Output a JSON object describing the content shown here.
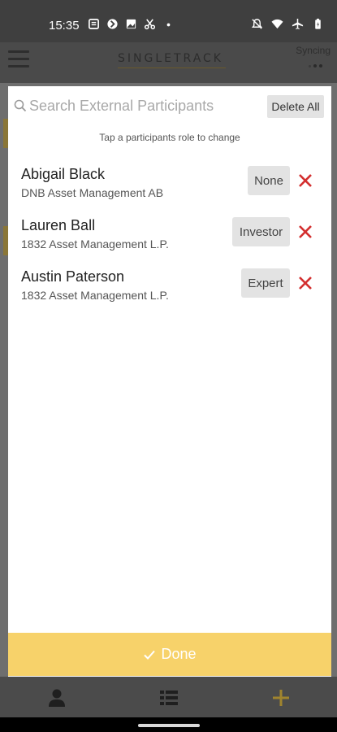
{
  "status_bar": {
    "time": "15:35",
    "left_icons": [
      "notes-icon",
      "circle-app-icon",
      "photo-icon",
      "scissors-icon",
      "dot-icon"
    ],
    "right_icons": [
      "mute-icon",
      "wifi-icon",
      "airplane-icon",
      "battery-icon"
    ]
  },
  "app_header": {
    "brand": "SINGLETRACK",
    "sync_status": "Syncing"
  },
  "search": {
    "placeholder": "Search External Participants",
    "value": ""
  },
  "delete_all_label": "Delete All",
  "hint": "Tap a participants role to change",
  "participants": [
    {
      "name": "Abigail Black",
      "company": "DNB Asset Management AB",
      "role": "None"
    },
    {
      "name": "Lauren Ball",
      "company": "1832 Asset Management L.P.",
      "role": "Investor"
    },
    {
      "name": "Austin Paterson",
      "company": "1832 Asset Management L.P.",
      "role": "Expert"
    }
  ],
  "done_label": "Done",
  "tab_bar": {
    "tabs": [
      "person-icon",
      "list-icon",
      "plus-icon"
    ],
    "active_color": "#a0842e"
  },
  "colors": {
    "accent_yellow": "#f7d26a",
    "remove_red": "#d32f2f"
  }
}
